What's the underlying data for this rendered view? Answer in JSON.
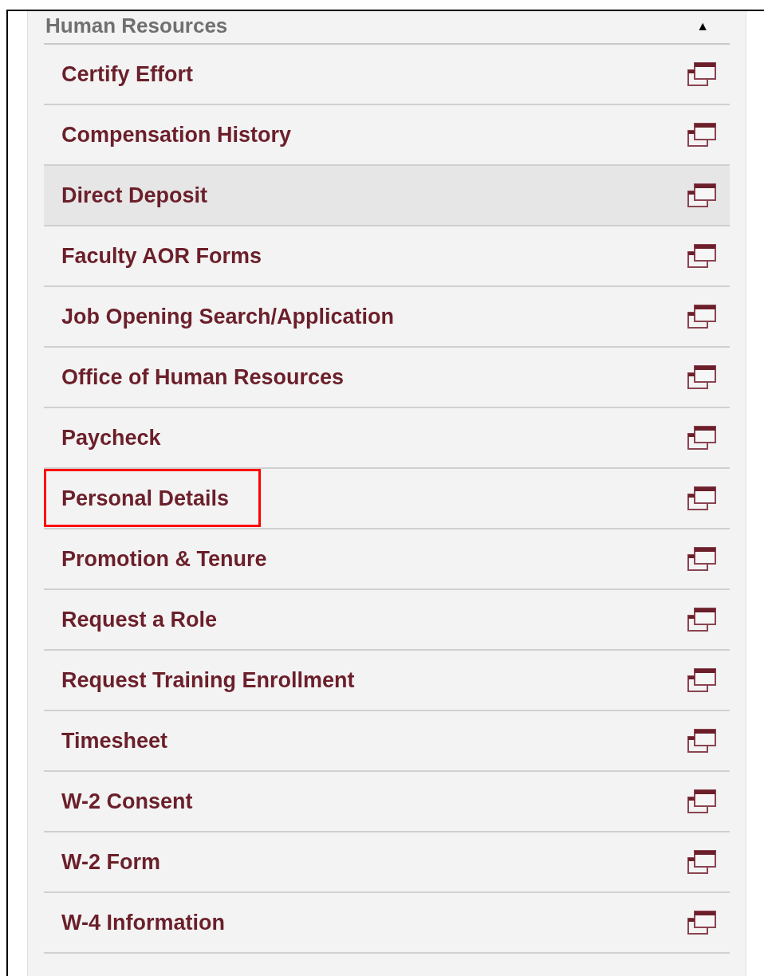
{
  "section": {
    "title": "Human Resources",
    "expanded": true,
    "toggle": "▲"
  },
  "items": [
    {
      "label": "Certify Effort",
      "selected": false,
      "annotated": false
    },
    {
      "label": "Compensation History",
      "selected": false,
      "annotated": false
    },
    {
      "label": "Direct Deposit",
      "selected": true,
      "annotated": false
    },
    {
      "label": "Faculty AOR Forms",
      "selected": false,
      "annotated": false
    },
    {
      "label": "Job Opening Search/Application",
      "selected": false,
      "annotated": false
    },
    {
      "label": "Office of Human Resources",
      "selected": false,
      "annotated": false
    },
    {
      "label": "Paycheck",
      "selected": false,
      "annotated": false
    },
    {
      "label": "Personal Details",
      "selected": false,
      "annotated": true
    },
    {
      "label": "Promotion & Tenure",
      "selected": false,
      "annotated": false
    },
    {
      "label": "Request a Role",
      "selected": false,
      "annotated": false
    },
    {
      "label": "Request Training Enrollment",
      "selected": false,
      "annotated": false
    },
    {
      "label": "Timesheet",
      "selected": false,
      "annotated": false
    },
    {
      "label": "W-2 Consent",
      "selected": false,
      "annotated": false
    },
    {
      "label": "W-2 Form",
      "selected": false,
      "annotated": false
    },
    {
      "label": "W-4 Information",
      "selected": false,
      "annotated": false
    }
  ]
}
